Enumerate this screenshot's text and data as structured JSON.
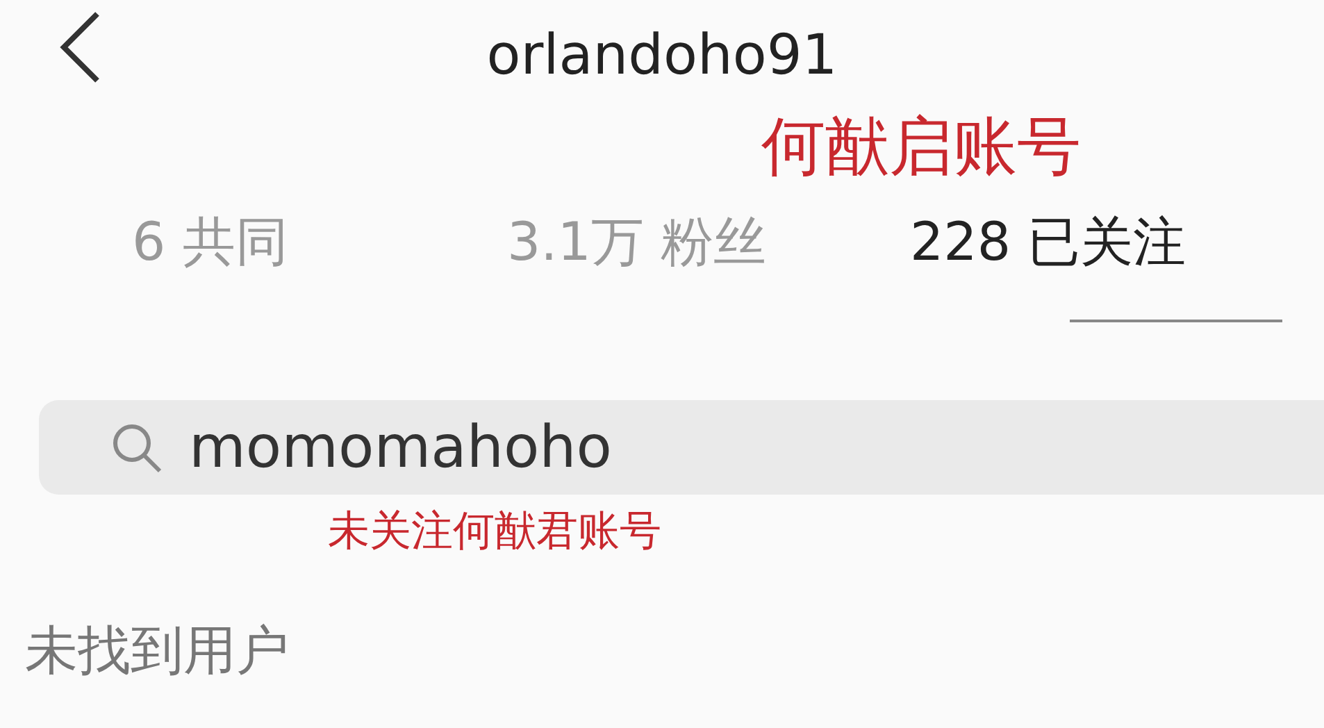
{
  "header": {
    "title": "orlandoho91"
  },
  "annotations": [
    {
      "text": "何猷启账号"
    },
    {
      "text": "未关注何猷君账号"
    }
  ],
  "stats": [
    {
      "value": "6",
      "label": "共同",
      "emphasized": false
    },
    {
      "value": "3.1万",
      "label": "粉丝",
      "emphasized": false
    },
    {
      "value": "228",
      "label": "已关注",
      "emphasized": true
    }
  ],
  "search": {
    "value": "momomahoho"
  },
  "empty_message": "未找到用户"
}
